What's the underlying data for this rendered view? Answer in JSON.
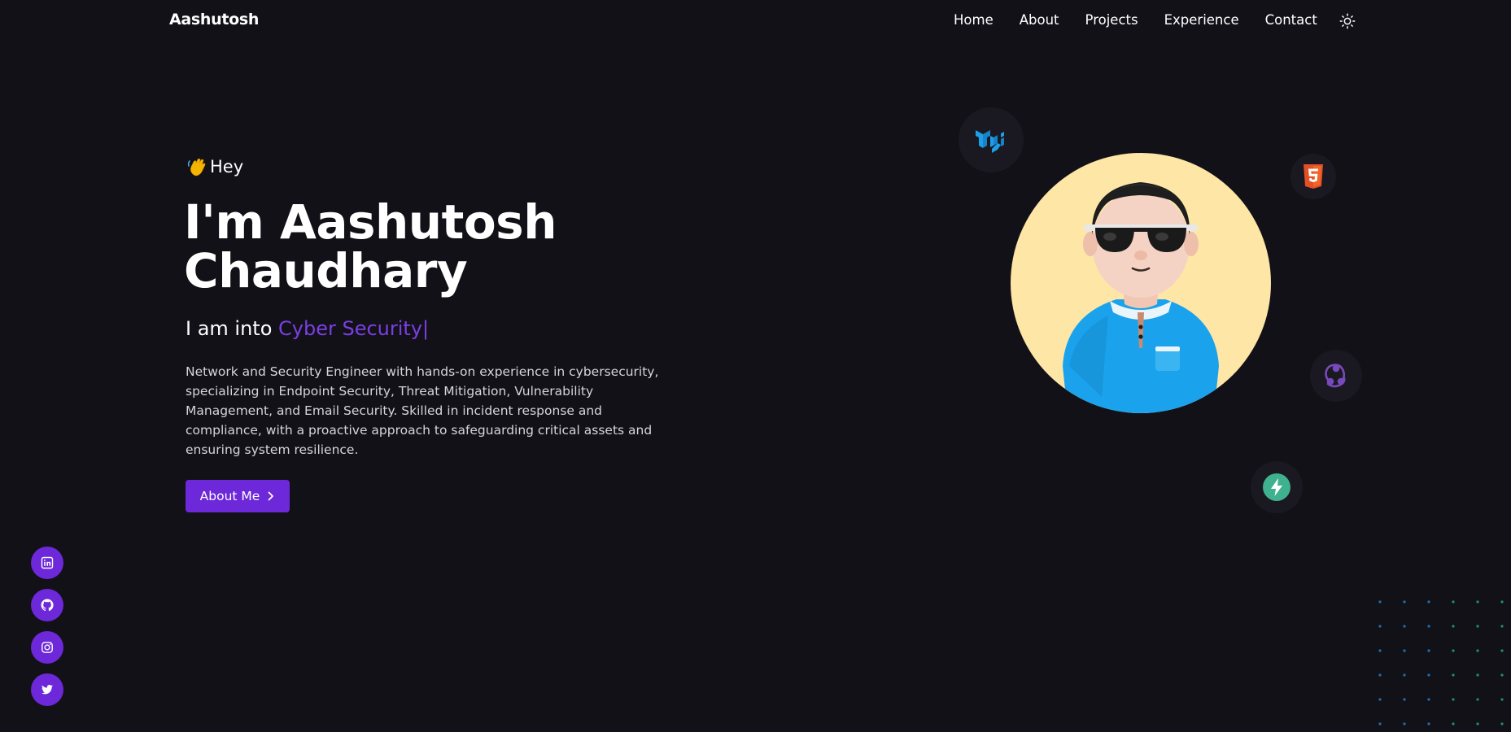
{
  "navbar": {
    "brand": "Aashutosh",
    "links": [
      "Home",
      "About",
      "Projects",
      "Experience",
      "Contact"
    ],
    "theme_icon": "sun-icon"
  },
  "hero": {
    "greeting": "Hey",
    "greeting_icon": "waving-hand-icon",
    "title_line1": "I'm Aashutosh",
    "title_line2": "Chaudhary",
    "tagline_prefix": "I am into",
    "tagline_highlight": "Cyber Security",
    "tagline_caret": "|",
    "bio": "Network and Security Engineer with hands-on experience in cybersecurity, specializing in Endpoint Security, Threat Mitigation, Vulnerability Management, and Email Security. Skilled in incident response and compliance, with a proactive approach to safeguarding critical assets and ensuring system resilience.",
    "cta_label": "About Me",
    "cta_icon": "chevron-right-icon"
  },
  "social": [
    {
      "name": "linkedin-icon"
    },
    {
      "name": "github-icon"
    },
    {
      "name": "instagram-icon"
    },
    {
      "name": "twitter-icon"
    }
  ],
  "orbit_icons": [
    "material-ui-icon",
    "html5-icon",
    "redux-icon",
    "supabase-icon"
  ],
  "colors": {
    "background": "#131118",
    "accent": "#6d28d9",
    "highlight": "#7b3fe4",
    "avatar_bg": "#fde6a6",
    "text": "#ffffff",
    "muted_text": "#d6d4dc"
  }
}
